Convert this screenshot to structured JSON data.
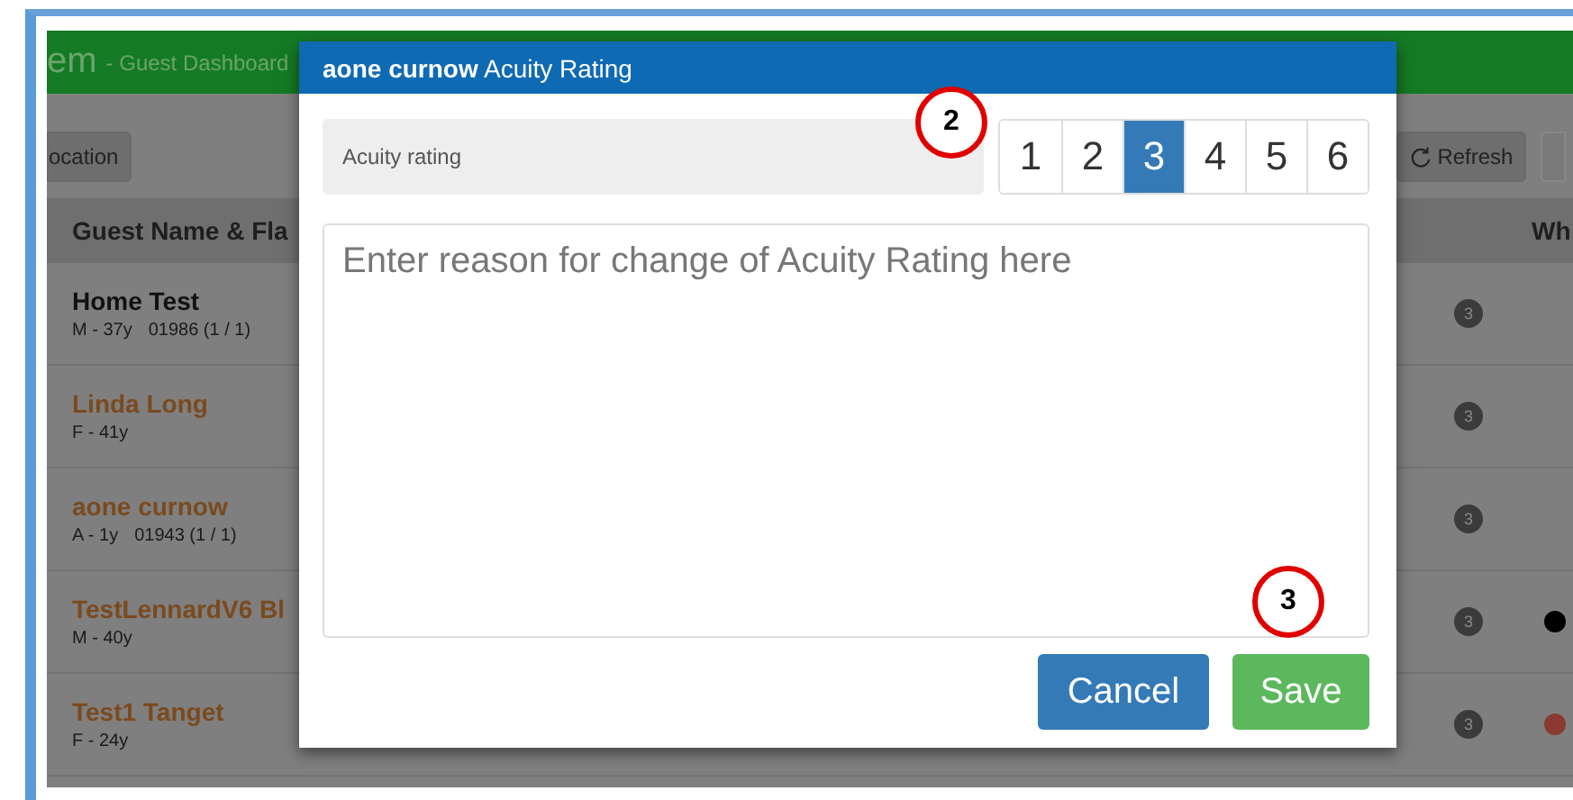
{
  "header": {
    "app_name": "em",
    "subtitle": "- Guest Dashboard"
  },
  "toolbar": {
    "left_button": "ocation",
    "refresh_button": "Refresh"
  },
  "table": {
    "columns": [
      "Guest Name & Fla",
      "Wh"
    ],
    "rows": [
      {
        "name": "Home Test",
        "color": "#111111",
        "meta": "M - 37y",
        "record": "01986 (1 / 1)",
        "badge": "3"
      },
      {
        "name": "Linda Long",
        "color": "#7a4a1e",
        "meta": "F - 41y",
        "badge": "3"
      },
      {
        "name": "aone curnow",
        "color": "#7a4a1e",
        "meta": "A - 1y",
        "record": "01943 (1 / 1)",
        "badge": "3"
      },
      {
        "name": "TestLennardV6 Bl",
        "color": "#7a4a1e",
        "meta": "M - 40y",
        "badge": "3",
        "status_dot": {
          "color": "#000000"
        }
      },
      {
        "name": "Test1 Tanget",
        "color": "#7a4a1e",
        "meta": "F - 24y",
        "badge": "3",
        "status_dot": {
          "color": "#8a3a30"
        }
      }
    ]
  },
  "modal": {
    "title": "**aone curnow** Acuity Rating",
    "label": "Acuity rating",
    "ratings": [
      {
        "label": "1",
        "selected": false
      },
      {
        "label": "2",
        "selected": false
      },
      {
        "label": "3",
        "selected": true
      },
      {
        "label": "4",
        "selected": false
      },
      {
        "label": "5",
        "selected": false
      },
      {
        "label": "6",
        "selected": false
      }
    ],
    "placeholder": "Enter reason for change of Acuity Rating here",
    "buttons": [
      {
        "label": "Cancel",
        "kind": "primary"
      },
      {
        "label": "Save",
        "kind": "success"
      }
    ]
  },
  "annotations": [
    {
      "label": "2"
    },
    {
      "label": "3"
    }
  ]
}
